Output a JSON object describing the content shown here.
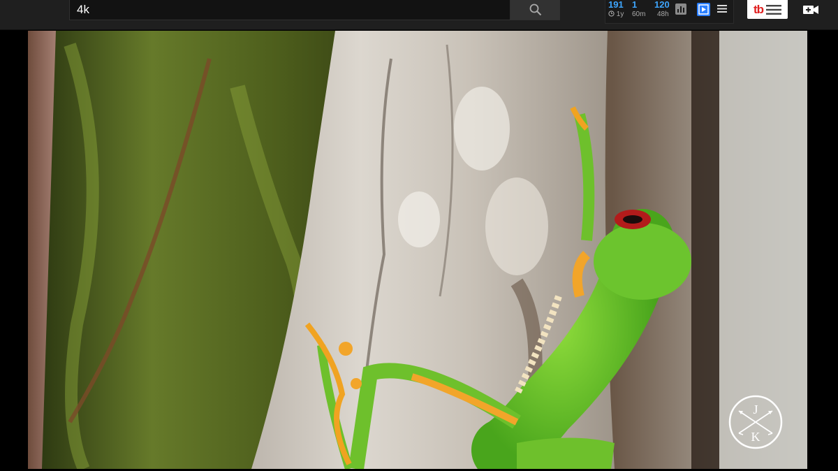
{
  "search": {
    "value": "4k",
    "placeholder": ""
  },
  "extension": {
    "stats": [
      {
        "value": "191",
        "label": "1y"
      },
      {
        "value": "1",
        "label": "60m"
      },
      {
        "value": "120",
        "label": "48h"
      }
    ]
  },
  "badge": {
    "text": "tb"
  },
  "watermark": {
    "top": "J",
    "bottom": "K"
  },
  "icons": {
    "search": "search-icon",
    "clock": "clock-icon",
    "chart": "bar-chart-icon",
    "menu": "menu-icon",
    "camera": "video-camera-add-icon"
  },
  "colors": {
    "topbar": "#1f1f1f",
    "accent": "#3ea6ff",
    "badge_red": "#e02020"
  }
}
